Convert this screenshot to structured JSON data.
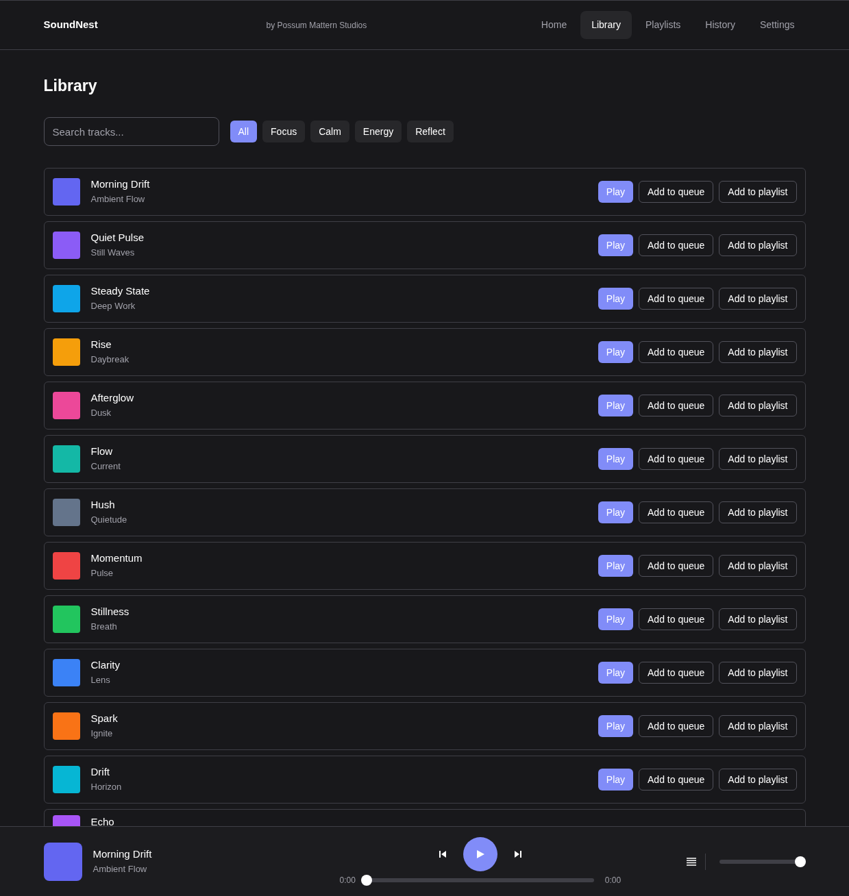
{
  "header": {
    "brand": "SoundNest",
    "byline": "by Possum Mattern Studios",
    "nav": [
      {
        "label": "Home",
        "selected": false
      },
      {
        "label": "Library",
        "selected": true
      },
      {
        "label": "Playlists",
        "selected": false
      },
      {
        "label": "History",
        "selected": false
      },
      {
        "label": "Settings",
        "selected": false
      }
    ]
  },
  "page_title": "Library",
  "search": {
    "placeholder": "Search tracks..."
  },
  "filters": [
    {
      "label": "All",
      "selected": true
    },
    {
      "label": "Focus",
      "selected": false
    },
    {
      "label": "Calm",
      "selected": false
    },
    {
      "label": "Energy",
      "selected": false
    },
    {
      "label": "Reflect",
      "selected": false
    }
  ],
  "tracks": [
    {
      "title": "Morning Drift",
      "artist": "Ambient Flow",
      "color": "#6366f1",
      "actions": [
        "Play",
        "Add to queue",
        "Add to playlist"
      ]
    },
    {
      "title": "Quiet Pulse",
      "artist": "Still Waves",
      "color": "#8b5cf6",
      "actions": [
        "Play",
        "Add to queue",
        "Add to playlist"
      ]
    },
    {
      "title": "Steady State",
      "artist": "Deep Work",
      "color": "#0ea5e9",
      "actions": [
        "Play",
        "Add to queue",
        "Add to playlist"
      ]
    },
    {
      "title": "Rise",
      "artist": "Daybreak",
      "color": "#f59e0b",
      "actions": [
        "Play",
        "Add to queue",
        "Add to playlist"
      ]
    },
    {
      "title": "Afterglow",
      "artist": "Dusk",
      "color": "#ec4899",
      "actions": [
        "Play",
        "Add to queue",
        "Add to playlist"
      ]
    },
    {
      "title": "Flow",
      "artist": "Current",
      "color": "#14b8a6",
      "actions": [
        "Play",
        "Add to queue",
        "Add to playlist"
      ]
    },
    {
      "title": "Hush",
      "artist": "Quietude",
      "color": "#64748b",
      "actions": [
        "Play",
        "Add to queue",
        "Add to playlist"
      ]
    },
    {
      "title": "Momentum",
      "artist": "Pulse",
      "color": "#ef4444",
      "actions": [
        "Play",
        "Add to queue",
        "Add to playlist"
      ]
    },
    {
      "title": "Stillness",
      "artist": "Breath",
      "color": "#22c55e",
      "actions": [
        "Play",
        "Add to queue",
        "Add to playlist"
      ]
    },
    {
      "title": "Clarity",
      "artist": "Lens",
      "color": "#3b82f6",
      "actions": [
        "Play",
        "Add to queue",
        "Add to playlist"
      ]
    },
    {
      "title": "Spark",
      "artist": "Ignite",
      "color": "#f97316",
      "actions": [
        "Play",
        "Add to queue",
        "Add to playlist"
      ]
    },
    {
      "title": "Drift",
      "artist": "Horizon",
      "color": "#06b6d4",
      "actions": [
        "Play",
        "Add to queue",
        "Add to playlist"
      ]
    },
    {
      "title": "Echo",
      "color": "#a855f7"
    }
  ],
  "player": {
    "title": "Morning Drift",
    "artist": "Ambient Flow",
    "color": "#6366f1",
    "elapsed": "0:00",
    "duration": "0:00",
    "progress": {
      "level": 0
    },
    "volume": {
      "level": 1
    }
  }
}
